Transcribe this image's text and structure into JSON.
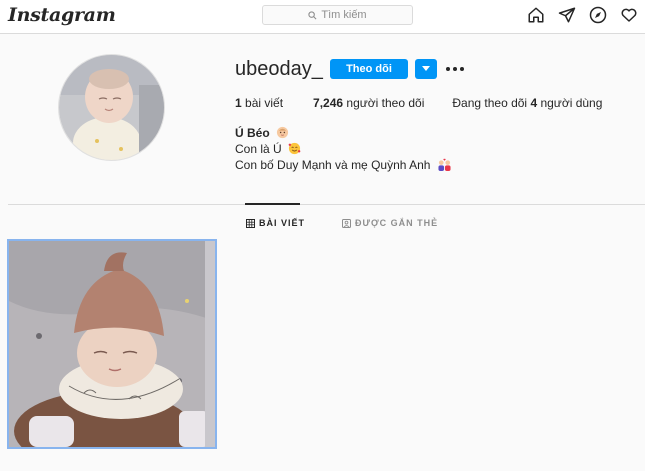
{
  "app": {
    "logo_text": "Instagram"
  },
  "search": {
    "placeholder": "Tìm kiếm"
  },
  "nav": {
    "icons": [
      "home-icon",
      "direct-icon",
      "explore-icon",
      "activity-icon"
    ]
  },
  "profile": {
    "username": "ubeoday_",
    "follow_label": "Theo dõi",
    "stats": {
      "posts_count": "1",
      "posts_label": " bài viết",
      "followers_count": "7,246",
      "followers_label": " người theo dõi",
      "following_prefix": "Đang theo dõi ",
      "following_count": "4",
      "following_suffix": " người dùng"
    },
    "bio": {
      "name": "Ú Béo",
      "line1": "Con là Ú",
      "line2": "Con bố Duy Mạnh và mẹ Quỳnh Anh"
    }
  },
  "tabs": {
    "posts_label": "BÀI VIẾT",
    "tagged_label": "ĐƯỢC GẮN THẺ"
  },
  "colors": {
    "accent": "#0095f6",
    "border": "#dbdbdb",
    "muted": "#8e8e8e",
    "selected_post_outline": "#88b4ee"
  }
}
